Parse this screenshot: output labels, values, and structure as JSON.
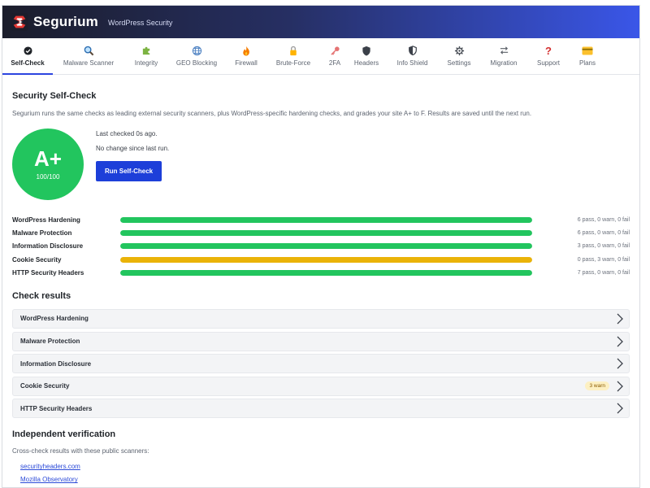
{
  "header": {
    "brand": "Segurium",
    "tagline": "WordPress Security"
  },
  "tabs": [
    {
      "label": "Self-Check",
      "icon": "check-circle-icon",
      "active": true
    },
    {
      "label": "Malware Scanner",
      "icon": "magnifier-icon"
    },
    {
      "label": "Integrity",
      "icon": "puzzle-icon"
    },
    {
      "label": "GEO Blocking",
      "icon": "globe-icon"
    },
    {
      "label": "Firewall",
      "icon": "fire-icon"
    },
    {
      "label": "Brute-Force",
      "icon": "lock-icon"
    },
    {
      "label": "2FA",
      "icon": "key-icon"
    },
    {
      "label": "Headers",
      "icon": "shield-icon"
    },
    {
      "label": "Info Shield",
      "icon": "shield-half-icon"
    },
    {
      "label": "Settings",
      "icon": "gear-icon"
    },
    {
      "label": "Migration",
      "icon": "arrows-icon"
    },
    {
      "label": "Support",
      "icon": "question-icon"
    },
    {
      "label": "Plans",
      "icon": "card-icon"
    }
  ],
  "selfcheck": {
    "title": "Security Self-Check",
    "description": "Segurium runs the same checks as leading external security scanners, plus WordPress-specific hardening checks, and grades your site A+ to F. Results are saved until the next run.",
    "grade": "A+",
    "score": "100/100",
    "last_checked": "Last checked 0s ago.",
    "change_note": "No change since last run.",
    "run_button": "Run Self-Check"
  },
  "colors": {
    "pass": "#22c55e",
    "warn": "#eab308",
    "accent": "#1d3fd9"
  },
  "categories": [
    {
      "label": "WordPress Hardening",
      "summary": "6 pass, 0 warn, 0 fail",
      "level": 1.0,
      "status": "pass"
    },
    {
      "label": "Malware Protection",
      "summary": "6 pass, 0 warn, 0 fail",
      "level": 1.0,
      "status": "pass"
    },
    {
      "label": "Information Disclosure",
      "summary": "3 pass, 0 warn, 0 fail",
      "level": 1.0,
      "status": "pass"
    },
    {
      "label": "Cookie Security",
      "summary": "0 pass, 3 warn, 0 fail",
      "level": 1.0,
      "status": "warn"
    },
    {
      "label": "HTTP Security Headers",
      "summary": "7 pass, 0 warn, 0 fail",
      "level": 1.0,
      "status": "pass"
    }
  ],
  "results": {
    "title": "Check results",
    "items": [
      {
        "label": "WordPress Hardening",
        "badge": ""
      },
      {
        "label": "Malware Protection",
        "badge": ""
      },
      {
        "label": "Information Disclosure",
        "badge": ""
      },
      {
        "label": "Cookie Security",
        "badge": "3 warn"
      },
      {
        "label": "HTTP Security Headers",
        "badge": ""
      }
    ]
  },
  "verification": {
    "title": "Independent verification",
    "description": "Cross-check results with these public scanners:",
    "links": [
      "securityheaders.com",
      "Mozilla Observatory"
    ]
  }
}
